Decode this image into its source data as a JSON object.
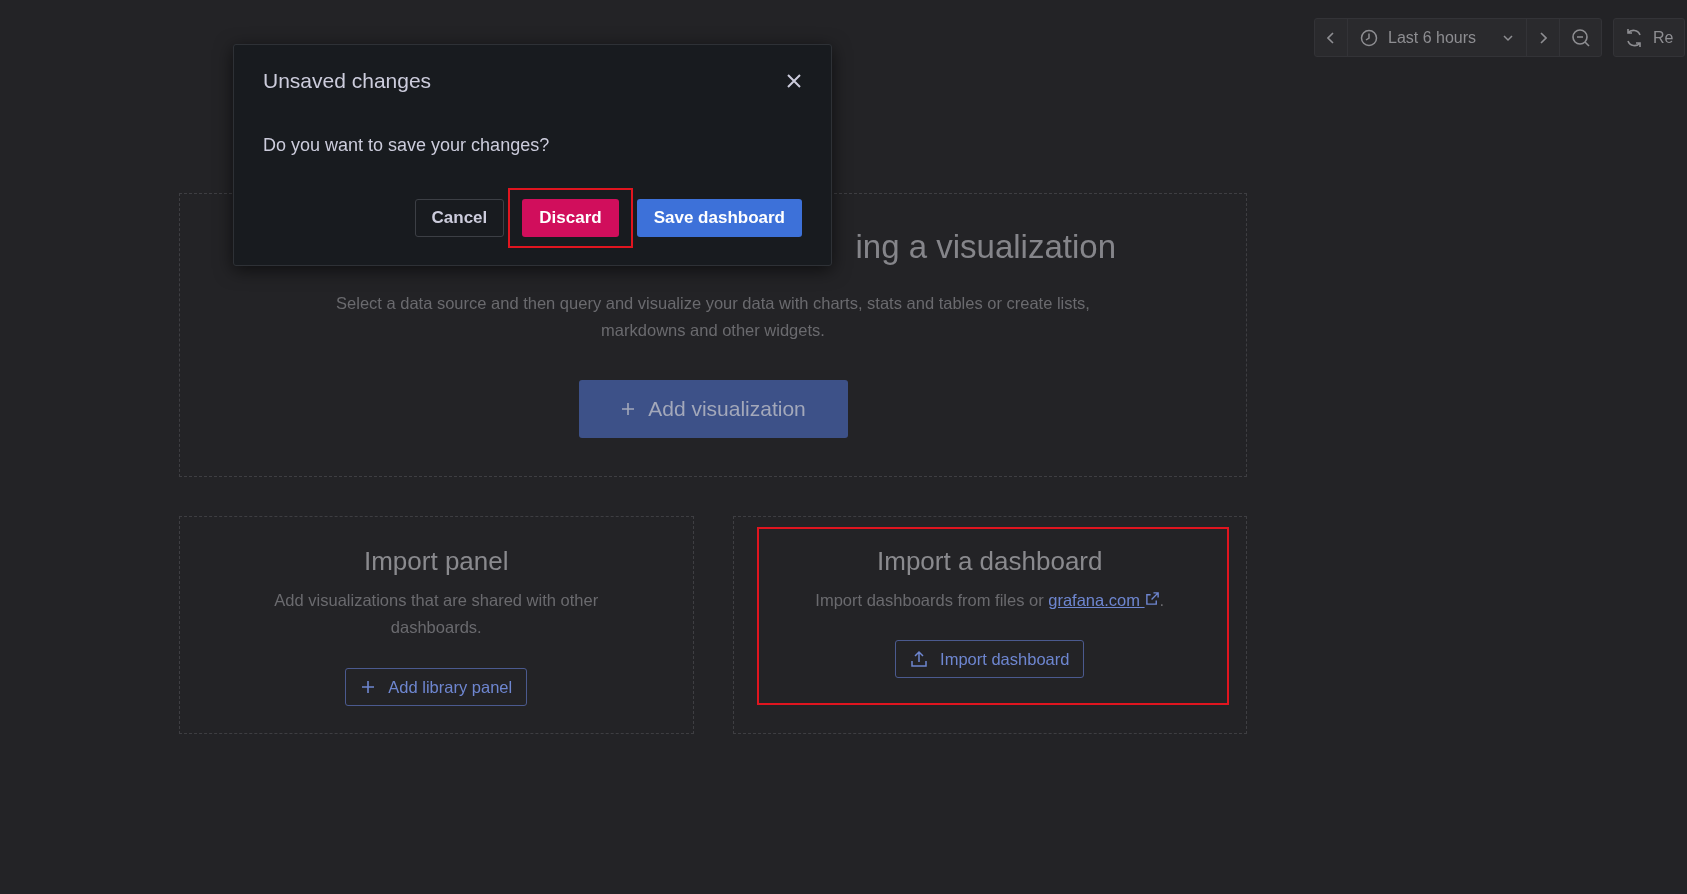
{
  "toolbar": {
    "time_range": "Last 6 hours",
    "refresh_label": "Re"
  },
  "dialog": {
    "title": "Unsaved changes",
    "message": "Do you want to save your changes?",
    "buttons": [
      {
        "label": "Cancel",
        "kind": "secondary",
        "highlighted": false
      },
      {
        "label": "Discard",
        "kind": "destructive",
        "highlighted": true
      },
      {
        "label": "Save dashboard",
        "kind": "primary",
        "highlighted": false
      }
    ]
  },
  "add_card": {
    "heading": "ing a visualization",
    "description": "Select a data source and then query and visualize your data with charts, stats and tables or create lists, markdowns and other widgets.",
    "button": "Add visualization"
  },
  "import_cards": [
    {
      "heading": "Import panel",
      "description": "Add visualizations that are shared with other dashboards.",
      "button": "Add library panel",
      "kind": "library",
      "highlighted": false
    },
    {
      "heading": "Import a dashboard",
      "description": "Import dashboards from files or ",
      "link": "grafana.com",
      "description_end": ".",
      "button": "Import dashboard",
      "kind": "import",
      "highlighted": true
    }
  ]
}
